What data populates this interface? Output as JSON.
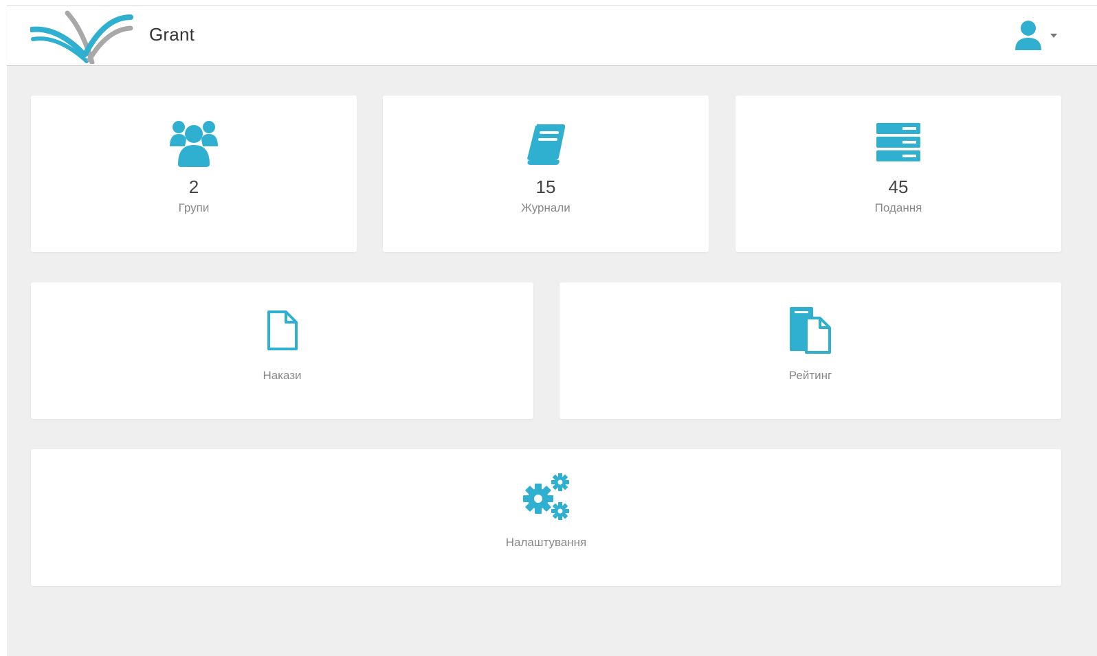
{
  "app": {
    "title": "Grant"
  },
  "header": {
    "user_icon": "user-icon",
    "caret_icon": "caret-down-icon"
  },
  "colors": {
    "accent": "#30b0d0",
    "logo_gray": "#a8a8a8",
    "background": "#efefef"
  },
  "tiles": [
    {
      "icon": "users-icon",
      "count": "2",
      "label": "Групи"
    },
    {
      "icon": "book-icon",
      "count": "15",
      "label": "Журнали"
    },
    {
      "icon": "server-icon",
      "count": "45",
      "label": "Подання"
    },
    {
      "icon": "file-icon",
      "label": "Накази"
    },
    {
      "icon": "copy-icon",
      "label": "Рейтинг"
    },
    {
      "icon": "gears-icon",
      "label": "Налаштування"
    }
  ]
}
